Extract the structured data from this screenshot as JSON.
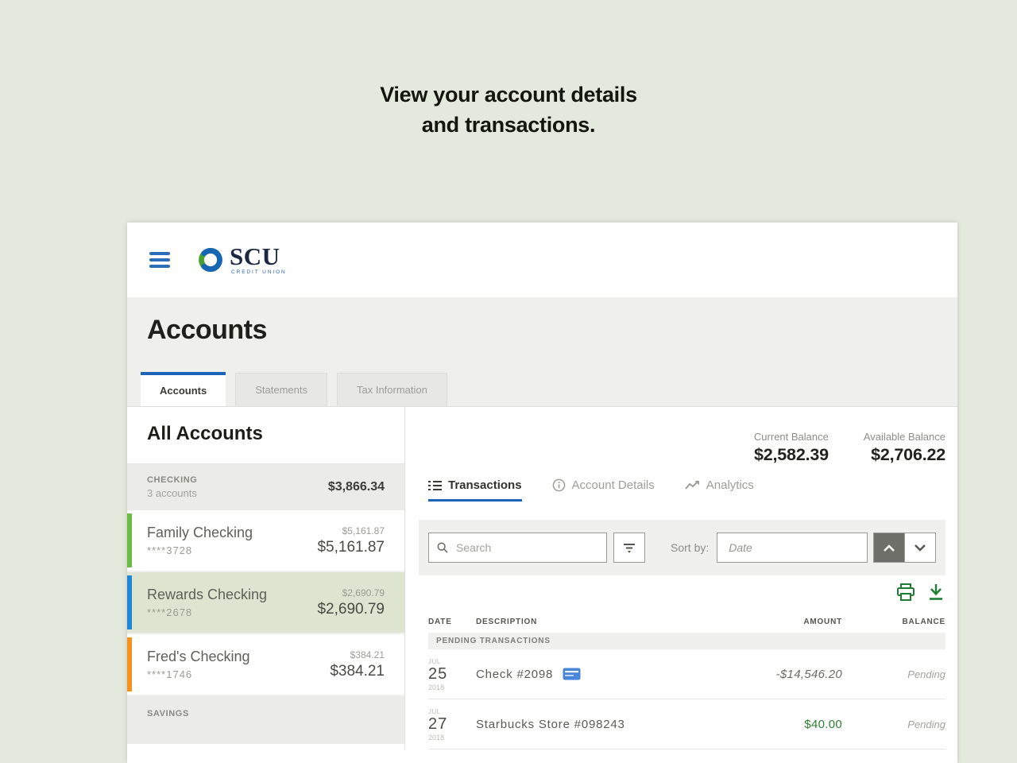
{
  "headline": {
    "line1": "View your account details",
    "line2": "and transactions."
  },
  "appbar": {
    "menu_icon": "hamburger-icon",
    "logo_text": "SCU",
    "logo_subtext": "CREDIT UNION"
  },
  "page_header": {
    "title": "Accounts",
    "tabs": [
      {
        "label": "Accounts",
        "active": true
      },
      {
        "label": "Statements",
        "active": false
      },
      {
        "label": "Tax Information",
        "active": false
      }
    ]
  },
  "sidebar": {
    "title": "All Accounts",
    "checking_group": {
      "label": "CHECKING",
      "sublabel": "3 accounts",
      "total": "$3,866.34"
    },
    "accounts": [
      {
        "name": "Family Checking",
        "mask": "****3728",
        "amount_small": "$5,161.87",
        "amount_large": "$5,161.87",
        "bar_color": "#6abe44",
        "selected": false
      },
      {
        "name": "Rewards Checking",
        "mask": "****2678",
        "amount_small": "$2,690.79",
        "amount_large": "$2,690.79",
        "bar_color": "#1e87d6",
        "selected": true
      },
      {
        "name": "Fred's Checking",
        "mask": "****1746",
        "amount_small": "$384.21",
        "amount_large": "$384.21",
        "bar_color": "#f6931d",
        "selected": false
      }
    ],
    "savings_group": {
      "label": "SAVINGS"
    }
  },
  "panel": {
    "balances": {
      "current_label": "Current Balance",
      "current_value": "$2,582.39",
      "available_label": "Available Balance",
      "available_value": "$2,706.22"
    },
    "tabs": [
      {
        "label": "Transactions",
        "icon": "list-icon",
        "active": true
      },
      {
        "label": "Account Details",
        "icon": "info-icon",
        "active": false
      },
      {
        "label": "Analytics",
        "icon": "trend-icon",
        "active": false
      }
    ],
    "filter_bar": {
      "search_placeholder": "Search",
      "sort_label": "Sort by:",
      "sort_placeholder": "Date"
    },
    "table": {
      "headers": {
        "date": "DATE",
        "description": "DESCRIPTION",
        "amount": "AMOUNT",
        "balance": "BALANCE"
      },
      "section_label": "PENDING TRANSACTIONS",
      "rows": [
        {
          "month": "JUL",
          "day": "25",
          "year": "2018",
          "description": "Check #2098",
          "amount": "-$14,546.20",
          "balance": "Pending"
        },
        {
          "month": "JUL",
          "day": "27",
          "year": "2018",
          "description": "Starbucks Store #098243",
          "amount": "$40.00",
          "balance": "Pending"
        }
      ]
    }
  },
  "colors": {
    "page_bg": "#e3e9dd",
    "accent_blue": "#1b64b8",
    "icon_green": "#1e7c33",
    "bar_green": "#6abe44",
    "bar_blue": "#1e87d6",
    "bar_orange": "#f6931d",
    "selected_account_bg": "#dde5d1",
    "positive_amount": "#2e7d32"
  }
}
